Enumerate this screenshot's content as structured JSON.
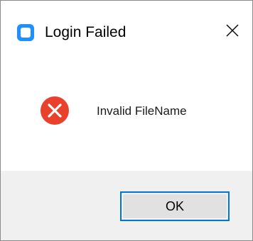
{
  "window": {
    "title": "Login Failed",
    "app_icon": "app-icon",
    "close_icon": "close-icon"
  },
  "dialog": {
    "icon": "error-icon",
    "message": "Invalid FileName"
  },
  "buttons": {
    "ok_label": "OK"
  },
  "colors": {
    "accent": "#0078d7",
    "error": "#e8412c",
    "footer_bg": "#f0f0f0"
  }
}
